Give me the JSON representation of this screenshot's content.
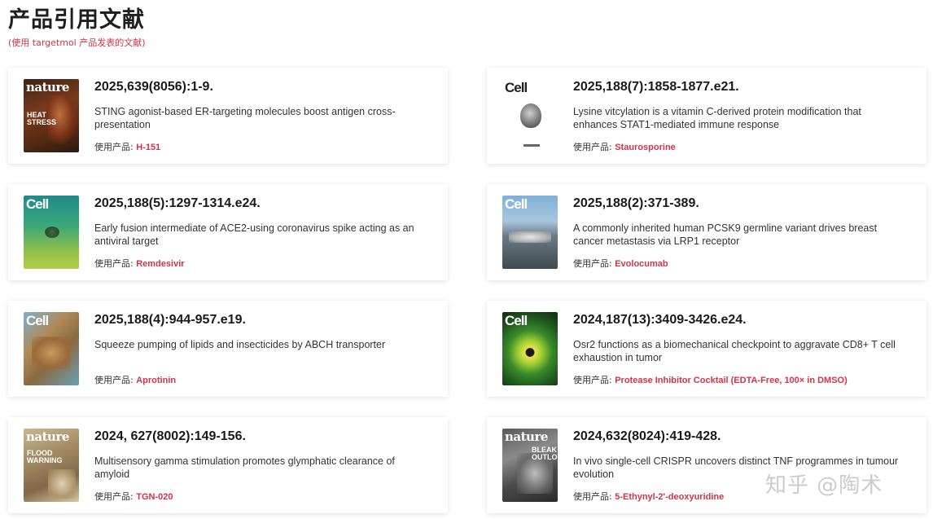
{
  "header": {
    "title": "产品引用文献",
    "subtitle": "(使用 targetmol 产品发表的文献)"
  },
  "product_label": "使用产品:",
  "watermark": "知乎 @陶术",
  "cards": [
    {
      "journal": "nature",
      "cover_text": "HEAT STRESS",
      "reference": "2025,639(8056):1-9.",
      "title": "STING agonist-based ER-targeting molecules boost antigen cross-presentation",
      "product": "H-151"
    },
    {
      "journal": "Cell",
      "cover_text": "",
      "reference": "2025,188(7):1858-1877.e21.",
      "title": "Lysine vitcylation is a vitamin C-derived protein modification that enhances STAT1-mediated immune response",
      "product": "Staurosporine"
    },
    {
      "journal": "Cell",
      "cover_text": "",
      "reference": "2025,188(5):1297-1314.e24.",
      "title": "Early fusion intermediate of ACE2-using coronavirus spike acting as an antiviral target",
      "product": "Remdesivir"
    },
    {
      "journal": "Cell",
      "cover_text": "",
      "reference": "2025,188(2):371-389.",
      "title": "A commonly inherited human PCSK9 germline variant drives breast cancer metastasis via LRP1 receptor",
      "product": "Evolocumab"
    },
    {
      "journal": "Cell",
      "cover_text": "",
      "reference": "2025,188(4):944-957.e19.",
      "title": "Squeeze pumping of lipids and insecticides by ABCH transporter",
      "product": "Aprotinin"
    },
    {
      "journal": "Cell",
      "cover_text": "",
      "reference": "2024,187(13):3409-3426.e24.",
      "title": "Osr2 functions as a biomechanical checkpoint to aggravate CD8+ T cell exhaustion in tumor",
      "product": "Protease Inhibitor Cocktail (EDTA-Free, 100× in DMSO)"
    },
    {
      "journal": "nature",
      "cover_text": "FLOOD WARNING",
      "reference": "2024, 627(8002):149-156.",
      "title": "Multisensory gamma stimulation promotes glymphatic clearance of amyloid",
      "product": "TGN-020"
    },
    {
      "journal": "nature",
      "cover_text": "BLEAK OUTLOOK",
      "reference": "2024,632(8024):419-428.",
      "title": "In vivo single-cell CRISPR uncovers distinct TNF programmes in tumour evolution",
      "product": "5-Ethynyl-2'-deoxyuridine"
    }
  ],
  "colors": {
    "accent": "#d0344a",
    "title": "#1f1f1f",
    "card_bg": "#ffffff"
  }
}
